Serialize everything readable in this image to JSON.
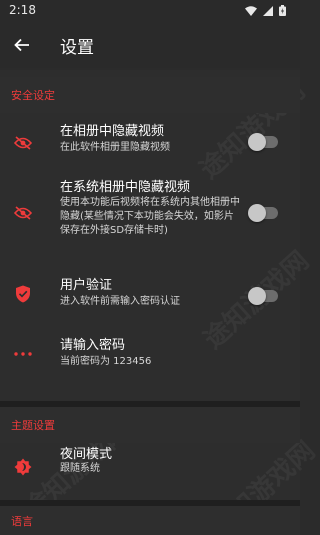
{
  "status_bar": {
    "time": "2:18"
  },
  "app_bar": {
    "title": "设置"
  },
  "sections": {
    "security": {
      "header": "安全设定",
      "hide_video": {
        "title": "在相册中隐藏视频",
        "subtitle": "在此软件相册里隐藏视频",
        "enabled": false
      },
      "hide_system": {
        "title": "在系统相册中隐藏视频",
        "subtitle": "使用本功能后视频将在系统内其他相册中隐藏(某些情况下本功能会失效，如影片保存在外接SD存储卡时)",
        "enabled": false
      },
      "user_auth": {
        "title": "用户验证",
        "subtitle": "进入软件前需输入密码认证",
        "enabled": false
      },
      "password": {
        "title": "请输入密码",
        "subtitle": "当前密码为 123456"
      }
    },
    "theme": {
      "header": "主题设置",
      "night_mode": {
        "title": "夜间模式",
        "subtitle": "跟随系统"
      }
    },
    "language": {
      "header": "语言"
    }
  },
  "colors": {
    "accent": "#ef3b3b",
    "background": "#2d2d2d",
    "divider": "#1f1f1f"
  },
  "watermark": "途知游戏网"
}
